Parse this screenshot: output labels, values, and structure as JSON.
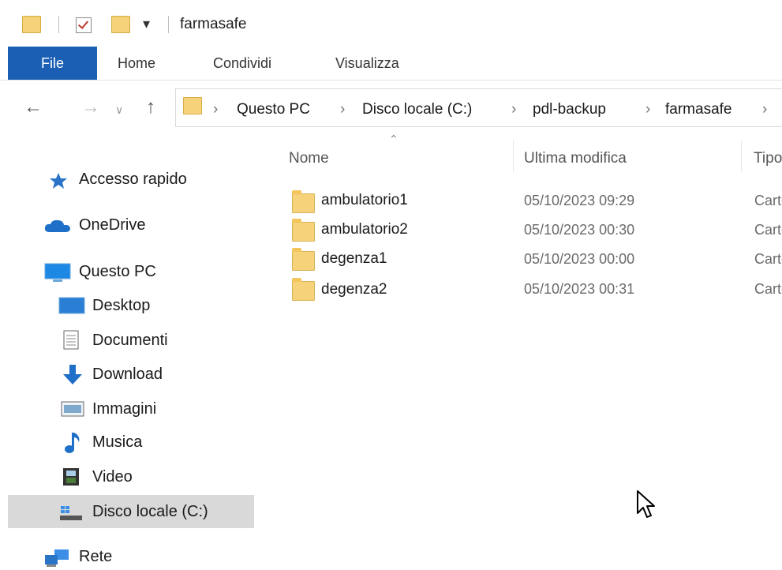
{
  "window": {
    "title": "farmasafe"
  },
  "ribbon": {
    "tabs": [
      "File",
      "Home",
      "Condividi",
      "Visualizza"
    ]
  },
  "address": {
    "crumbs": [
      "Questo PC",
      "Disco locale (C:)",
      "pdl-backup",
      "farmasafe"
    ]
  },
  "nav": {
    "items": [
      {
        "label": "Accesso rapido",
        "icon": "star-icon"
      },
      {
        "label": "OneDrive",
        "icon": "cloud-icon"
      },
      {
        "label": "Questo PC",
        "icon": "computer-icon"
      },
      {
        "label": "Desktop",
        "icon": "desktop-icon"
      },
      {
        "label": "Documenti",
        "icon": "document-icon"
      },
      {
        "label": "Download",
        "icon": "download-icon"
      },
      {
        "label": "Immagini",
        "icon": "image-icon"
      },
      {
        "label": "Musica",
        "icon": "music-icon"
      },
      {
        "label": "Video",
        "icon": "video-icon"
      },
      {
        "label": "Disco locale (C:)",
        "icon": "drive-icon"
      },
      {
        "label": "Rete",
        "icon": "network-icon"
      }
    ]
  },
  "columns": {
    "name": "Nome",
    "modified": "Ultima modifica",
    "type": "Tipo"
  },
  "files": [
    {
      "name": "ambulatorio1",
      "modified": "05/10/2023 09:29",
      "type": "Cartella di file"
    },
    {
      "name": "ambulatorio2",
      "modified": "05/10/2023 00:30",
      "type": "Cartella di file"
    },
    {
      "name": "degenza1",
      "modified": "05/10/2023 00:00",
      "type": "Cartella di file"
    },
    {
      "name": "degenza2",
      "modified": "05/10/2023 00:31",
      "type": "Cartella di file"
    }
  ]
}
